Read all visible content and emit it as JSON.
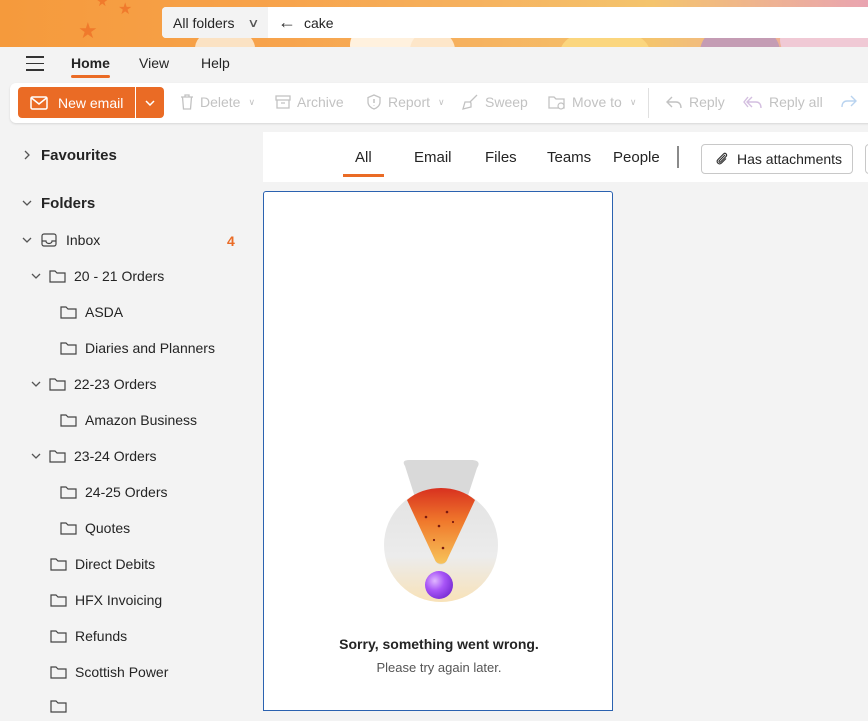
{
  "search": {
    "scope_label": "All folders",
    "query": "cake"
  },
  "menu": {
    "tabs": [
      "Home",
      "View",
      "Help"
    ],
    "active": "Home"
  },
  "ribbon": {
    "new_email": "New email",
    "delete": "Delete",
    "archive": "Archive",
    "report": "Report",
    "sweep": "Sweep",
    "move_to": "Move to",
    "reply": "Reply",
    "reply_all": "Reply all"
  },
  "sidebar": {
    "favourites": "Favourites",
    "folders": "Folders",
    "inbox": {
      "label": "Inbox",
      "count": "4"
    },
    "items": [
      {
        "label": "20 - 21 Orders"
      },
      {
        "label": "ASDA"
      },
      {
        "label": "Diaries and Planners"
      },
      {
        "label": "22-23 Orders"
      },
      {
        "label": "Amazon Business"
      },
      {
        "label": "23-24 Orders"
      },
      {
        "label": "24-25 Orders"
      },
      {
        "label": "Quotes"
      },
      {
        "label": "Direct Debits"
      },
      {
        "label": "HFX Invoicing"
      },
      {
        "label": "Refunds"
      },
      {
        "label": "Scottish Power"
      }
    ]
  },
  "filters": {
    "tabs": [
      "All",
      "Email",
      "Files",
      "Teams",
      "People"
    ],
    "active": "All",
    "has_attachments": "Has attachments"
  },
  "error": {
    "title": "Sorry, something went wrong.",
    "subtitle": "Please try again later."
  },
  "colors": {
    "accent": "#ea6b25",
    "panel_border": "#2b62b0"
  }
}
